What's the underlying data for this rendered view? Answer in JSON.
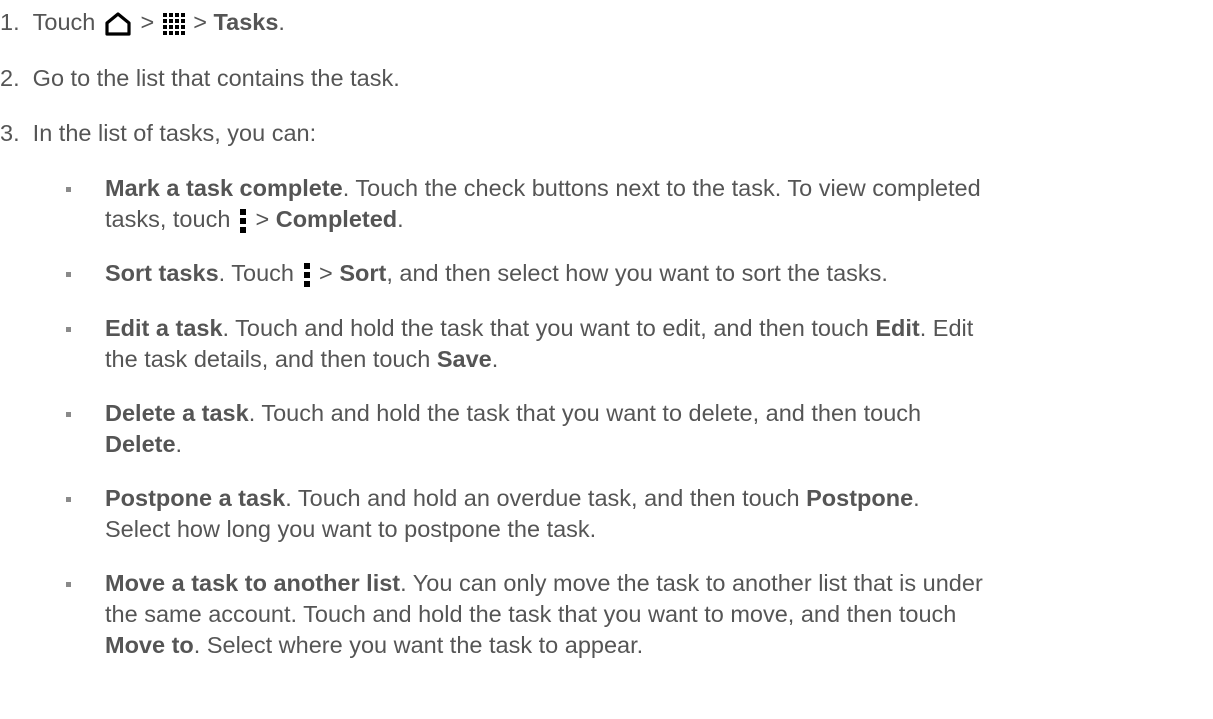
{
  "steps": [
    {
      "num": "1.",
      "p1": "Touch ",
      "sep1": " > ",
      "sep2": " > ",
      "target": "Tasks",
      "end": "."
    },
    {
      "num": "2.",
      "text": "Go to the list that contains the task."
    },
    {
      "num": "3.",
      "text": "In the list of tasks, you can:"
    }
  ],
  "bullets": {
    "mark": {
      "title": "Mark a task complete",
      "l1": ". Touch the check buttons next to the task. To view completed",
      "l2a": "tasks, touch ",
      "sep": " > ",
      "b1": "Completed",
      "end": "."
    },
    "sort": {
      "title": "Sort tasks",
      "a": ". Touch ",
      "sep": " > ",
      "b1": "Sort",
      "rest": ", and then select how you want to sort the tasks."
    },
    "edit": {
      "title": "Edit a task",
      "a": ". Touch and hold the task that you want to edit, and then touch ",
      "b1": "Edit",
      "c": ". Edit",
      "l2a": "the task details, and then touch ",
      "b2": "Save",
      "end": "."
    },
    "del": {
      "title": "Delete a task",
      "a": ". Touch and hold the task that you want to delete, and then touch",
      "b1": "Delete",
      "end": "."
    },
    "post": {
      "title": "Postpone a task",
      "a": ". Touch and hold an overdue task, and then touch ",
      "b1": "Postpone",
      "end": ".",
      "l2": "Select how long you want to postpone the task."
    },
    "move": {
      "title": "Move a task to another list",
      "a": ". You can only move the task to another list that is under",
      "l2": "the same account. Touch and hold the task that you want to move, and then touch",
      "b1": "Move to",
      "l3": ". Select where you want the task to appear."
    }
  },
  "icons": {
    "home": "home-icon",
    "apps": "apps-grid-icon",
    "menu": "menu-dots-icon"
  },
  "colors": {
    "text": "#555555"
  }
}
